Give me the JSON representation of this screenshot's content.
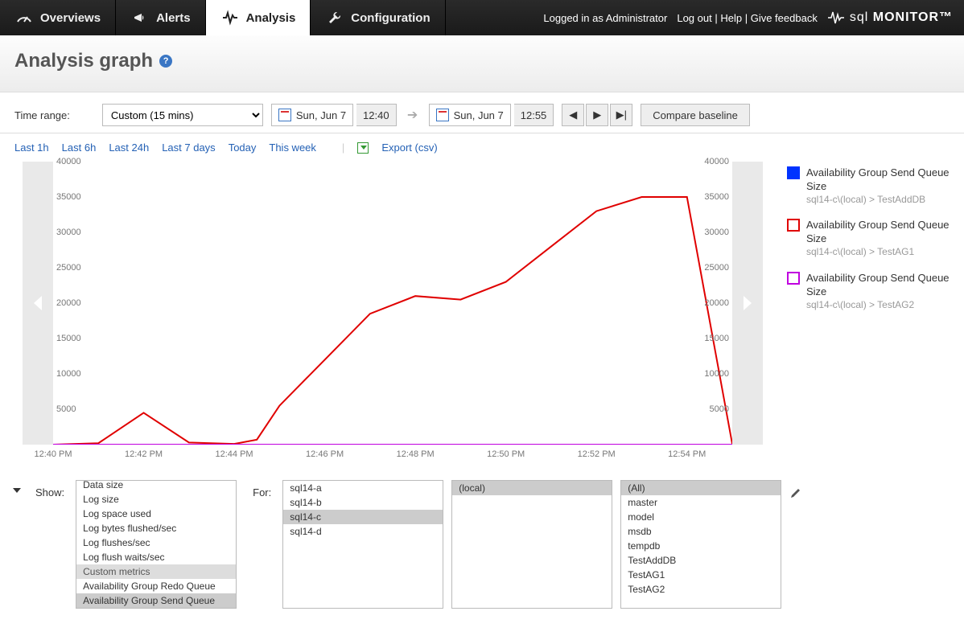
{
  "nav": {
    "tabs": [
      {
        "label": "Overviews",
        "icon": "gauge-icon"
      },
      {
        "label": "Alerts",
        "icon": "megaphone-icon"
      },
      {
        "label": "Analysis",
        "icon": "pulse-icon",
        "active": true
      },
      {
        "label": "Configuration",
        "icon": "wrench-icon"
      }
    ],
    "logged_in": "Logged in as Administrator",
    "logout": "Log out",
    "help": "Help",
    "feedback": "Give feedback",
    "logo_pre": "sql",
    "logo_post": "MONITOR™"
  },
  "page_title": "Analysis graph",
  "controls": {
    "time_range_label": "Time range:",
    "time_range_select": "Custom (15 mins)",
    "date_from": "Sun, Jun 7",
    "time_from": "12:40",
    "date_to": "Sun, Jun 7",
    "time_to": "12:55",
    "compare": "Compare baseline"
  },
  "quicklinks": [
    "Last 1h",
    "Last 6h",
    "Last 24h",
    "Last 7 days",
    "Today",
    "This week"
  ],
  "export_label": "Export (csv)",
  "chart_data": {
    "type": "line",
    "title": "",
    "xlabel": "",
    "ylabel": "",
    "ylim": [
      0,
      40000
    ],
    "y_ticks": [
      5000,
      10000,
      15000,
      20000,
      25000,
      30000,
      35000,
      40000
    ],
    "x_ticks": [
      "12:40 PM",
      "12:42 PM",
      "12:44 PM",
      "12:46 PM",
      "12:48 PM",
      "12:50 PM",
      "12:52 PM",
      "12:54 PM"
    ],
    "x_minutes": [
      40,
      42,
      44,
      46,
      48,
      50,
      52,
      54
    ],
    "x_range": [
      40,
      55
    ],
    "series": [
      {
        "name": "Availability Group Send Queue Size",
        "source": "sql14-c\\(local) > TestAddDB",
        "color": "#0033ff",
        "fill": true,
        "x": [
          40,
          41,
          42,
          43,
          44,
          45,
          46,
          47,
          48,
          49,
          50,
          51,
          52,
          53,
          54,
          55
        ],
        "y": [
          0,
          0,
          0,
          0,
          0,
          0,
          0,
          0,
          0,
          0,
          0,
          0,
          0,
          0,
          0,
          0
        ]
      },
      {
        "name": "Availability Group Send Queue Size",
        "source": "sql14-c\\(local) > TestAG1",
        "color": "#e00000",
        "fill": false,
        "x": [
          40,
          41,
          42,
          43,
          44,
          44.5,
          45,
          46,
          47,
          48,
          49,
          50,
          51,
          52,
          53,
          54,
          55
        ],
        "y": [
          0,
          200,
          4500,
          300,
          100,
          700,
          5500,
          12000,
          18500,
          21000,
          20500,
          23000,
          28000,
          33000,
          35000,
          35000,
          100
        ]
      },
      {
        "name": "Availability Group Send Queue Size",
        "source": "sql14-c\\(local) > TestAG2",
        "color": "#c000e0",
        "fill": false,
        "x": [
          40,
          55
        ],
        "y": [
          0,
          0
        ]
      }
    ]
  },
  "selectors": {
    "show_label": "Show:",
    "show_items": [
      {
        "label": "Data size",
        "type": "opt"
      },
      {
        "label": "Log size",
        "type": "opt"
      },
      {
        "label": "Log space used",
        "type": "opt"
      },
      {
        "label": "Log bytes flushed/sec",
        "type": "opt"
      },
      {
        "label": "Log flushes/sec",
        "type": "opt"
      },
      {
        "label": "Log flush waits/sec",
        "type": "opt"
      },
      {
        "label": "Custom metrics",
        "type": "group"
      },
      {
        "label": "Availability Group Redo Queue",
        "type": "opt"
      },
      {
        "label": "Availability Group Send Queue",
        "type": "opt",
        "selected": true
      }
    ],
    "for_label": "For:",
    "for_items": [
      {
        "label": "sql14-a"
      },
      {
        "label": "sql14-b"
      },
      {
        "label": "sql14-c",
        "selected": true
      },
      {
        "label": "sql14-d"
      }
    ],
    "instance_items": [
      {
        "label": "(local)",
        "selected": true
      }
    ],
    "db_items": [
      {
        "label": "(All)",
        "selected": true
      },
      {
        "label": "master"
      },
      {
        "label": "model"
      },
      {
        "label": "msdb"
      },
      {
        "label": "tempdb"
      },
      {
        "label": "TestAddDB"
      },
      {
        "label": "TestAG1"
      },
      {
        "label": "TestAG2"
      }
    ]
  }
}
